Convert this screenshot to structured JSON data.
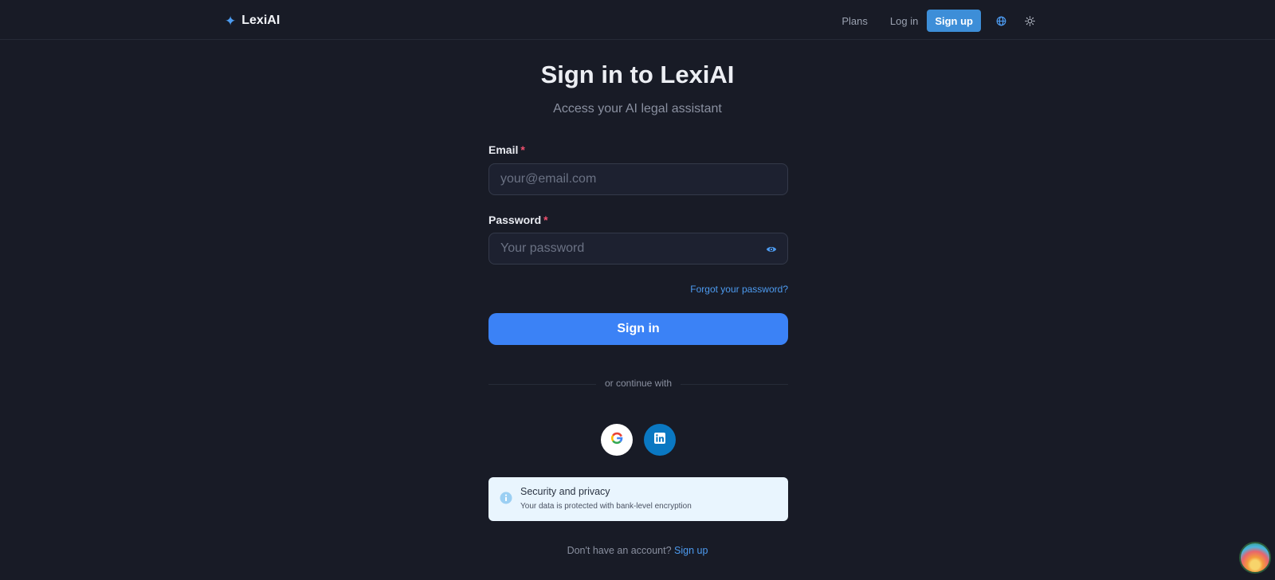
{
  "header": {
    "brand": "LexiAI",
    "brand_icon": "sparkle-icon",
    "nav": {
      "plans": "Plans",
      "login": "Log in",
      "signup": "Sign up",
      "language_icon": "globe-icon",
      "theme_icon": "sun-icon"
    }
  },
  "main": {
    "title": "Sign in to LexiAI",
    "subtitle": "Access your AI legal assistant",
    "email": {
      "label": "Email",
      "required_mark": "*",
      "placeholder": "your@email.com",
      "value": ""
    },
    "password": {
      "label": "Password",
      "required_mark": "*",
      "placeholder": "Your password",
      "value": ""
    },
    "forgot": "Forgot your password?",
    "signin": "Sign in",
    "divider": "or continue with",
    "social": {
      "google_icon": "google-icon",
      "linkedin_icon": "linkedin-icon"
    },
    "security": {
      "title": "Security and privacy",
      "text": "Your data is protected with bank-level encryption"
    },
    "footer": {
      "prompt": "Don't have an account?",
      "link": "Sign up"
    }
  },
  "colors": {
    "background": "#181b26",
    "accent": "#3b82f6",
    "link": "#4d9bf0",
    "required": "#f0506e",
    "notice_bg": "#e9f5fe"
  }
}
